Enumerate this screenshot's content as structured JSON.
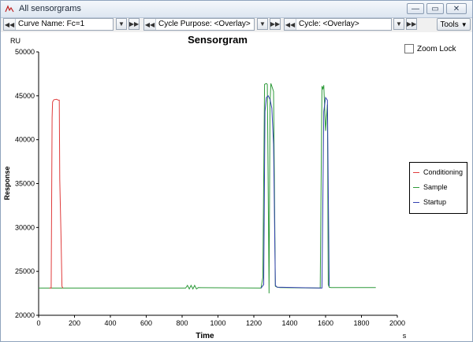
{
  "window": {
    "title": "All sensorgrams"
  },
  "toolbar": {
    "curve_label": "Curve Name: Fc=1",
    "purpose_label": "Cycle Purpose: <Overlay>",
    "cycle_label": "Cycle: <Overlay>",
    "tools_label": "Tools"
  },
  "zoom_lock": {
    "label": "Zoom Lock",
    "checked": false
  },
  "legend": [
    "Conditioning",
    "Sample",
    "Startup"
  ],
  "chart_data": {
    "type": "line",
    "title": "Sensorgram",
    "xlabel": "Time",
    "ylabel": "Response",
    "x_unit": "s",
    "y_unit": "RU",
    "xlim": [
      0,
      2000
    ],
    "ylim": [
      20000,
      50000
    ],
    "x_ticks": [
      0,
      200,
      400,
      600,
      800,
      1000,
      1200,
      1400,
      1600,
      1800,
      2000
    ],
    "y_ticks": [
      20000,
      25000,
      30000,
      35000,
      40000,
      45000,
      50000
    ],
    "grid": false,
    "legend_position": "right",
    "colors": {
      "Conditioning": "#e03b3b",
      "Sample": "#2e9a3a",
      "Startup": "#3340b0"
    },
    "series": [
      {
        "name": "Conditioning",
        "x": [
          60,
          70,
          75,
          78,
          85,
          100,
          110,
          115,
          118,
          125,
          130,
          135
        ],
        "y": [
          23100,
          23100,
          42500,
          44300,
          44550,
          44600,
          44500,
          44500,
          35500,
          29000,
          23300,
          23100
        ]
      },
      {
        "name": "Sample",
        "x": [
          0,
          820,
          830,
          840,
          850,
          860,
          870,
          880,
          890,
          1240,
          1250,
          1260,
          1270,
          1275,
          1285,
          1290,
          1295,
          1300,
          1310,
          1320,
          1330,
          1345,
          1570,
          1580,
          1585,
          1590,
          1600,
          1610,
          1615,
          1620,
          1630,
          1880
        ],
        "y": [
          23100,
          23100,
          23400,
          23000,
          23400,
          23000,
          23400,
          23000,
          23150,
          23100,
          24300,
          46300,
          46400,
          46300,
          22500,
          44000,
          46400,
          46100,
          45500,
          23300,
          23200,
          23150,
          23100,
          46100,
          45800,
          46200,
          41000,
          44000,
          23500,
          23200,
          23150,
          23150
        ]
      },
      {
        "name": "Startup",
        "x": [
          1240,
          1255,
          1262,
          1270,
          1280,
          1290,
          1300,
          1310,
          1320,
          1330,
          1580,
          1590,
          1600,
          1610,
          1620
        ],
        "y": [
          23100,
          23500,
          43200,
          44800,
          45000,
          44600,
          43600,
          39500,
          23400,
          23200,
          23100,
          43200,
          44800,
          44500,
          23300
        ]
      }
    ]
  }
}
